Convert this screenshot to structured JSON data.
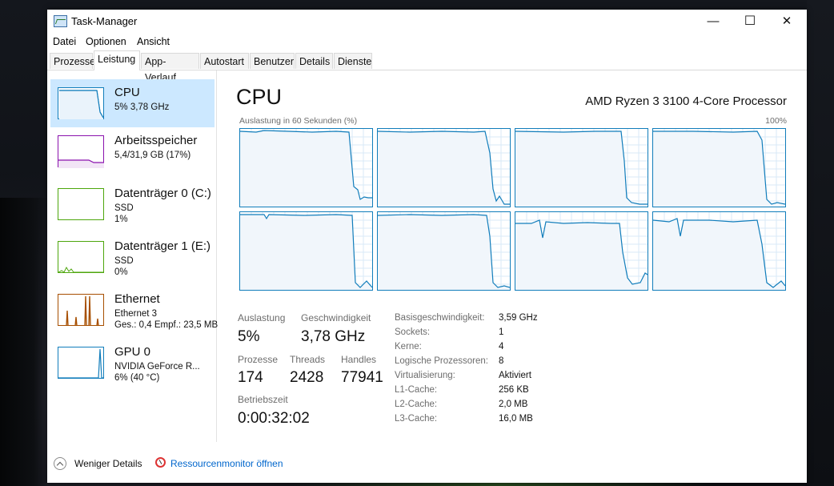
{
  "window": {
    "title": "Task-Manager",
    "minimize": "—",
    "maximize": "☐",
    "close": "✕"
  },
  "menu": [
    "Datei",
    "Optionen",
    "Ansicht"
  ],
  "tabs": [
    "Prozesse",
    "Leistung",
    "App-Verlauf",
    "Autostart",
    "Benutzer",
    "Details",
    "Dienste"
  ],
  "active_tab": "Leistung",
  "sidebar": [
    {
      "name": "CPU",
      "lines": [
        "5%  3,78 GHz"
      ],
      "color": "#117dbb",
      "selected": true
    },
    {
      "name": "Arbeitsspeicher",
      "lines": [
        "5,4/31,9 GB (17%)"
      ],
      "color": "#8b12ae"
    },
    {
      "name": "Datenträger 0 (C:)",
      "lines": [
        "SSD",
        "1%"
      ],
      "color": "#4da60c"
    },
    {
      "name": "Datenträger 1 (E:)",
      "lines": [
        "SSD",
        "0%"
      ],
      "color": "#4da60c"
    },
    {
      "name": "Ethernet",
      "lines": [
        "Ethernet 3",
        "Ges.: 0,4  Empf.: 23,5 MB"
      ],
      "color": "#a74f01"
    },
    {
      "name": "GPU 0",
      "lines": [
        "NVIDIA GeForce R...",
        "6% (40 °C)"
      ],
      "color": "#117dbb"
    }
  ],
  "main": {
    "title": "CPU",
    "processor": "AMD Ryzen 3 3100 4-Core Processor",
    "graph_label": "Auslastung in 60 Sekunden (%)",
    "graph_max": "100%",
    "stats": {
      "auslastung_label": "Auslastung",
      "auslastung": "5%",
      "geschwindigkeit_label": "Geschwindigkeit",
      "geschwindigkeit": "3,78 GHz",
      "prozesse_label": "Prozesse",
      "prozesse": "174",
      "threads_label": "Threads",
      "threads": "2428",
      "handles_label": "Handles",
      "handles": "77941",
      "betriebszeit_label": "Betriebszeit",
      "betriebszeit": "0:00:32:02"
    },
    "details": [
      {
        "label": "Basisgeschwindigkeit:",
        "value": "3,59 GHz"
      },
      {
        "label": "Sockets:",
        "value": "1"
      },
      {
        "label": "Kerne:",
        "value": "4"
      },
      {
        "label": "Logische Prozessoren:",
        "value": "8"
      },
      {
        "label": "Virtualisierung:",
        "value": "Aktiviert"
      },
      {
        "label": "L1-Cache:",
        "value": "256 KB"
      },
      {
        "label": "L2-Cache:",
        "value": "2,0 MB"
      },
      {
        "label": "L3-Cache:",
        "value": "16,0 MB"
      }
    ]
  },
  "footer": {
    "less_details": "Weniger Details",
    "resource_monitor": "Ressourcenmonitor öffnen"
  },
  "colors": {
    "cpu": "#117dbb",
    "memory": "#8b12ae",
    "disk": "#4da60c",
    "ethernet": "#a74f01",
    "selected": "#cce8ff",
    "link": "#0066cc"
  }
}
